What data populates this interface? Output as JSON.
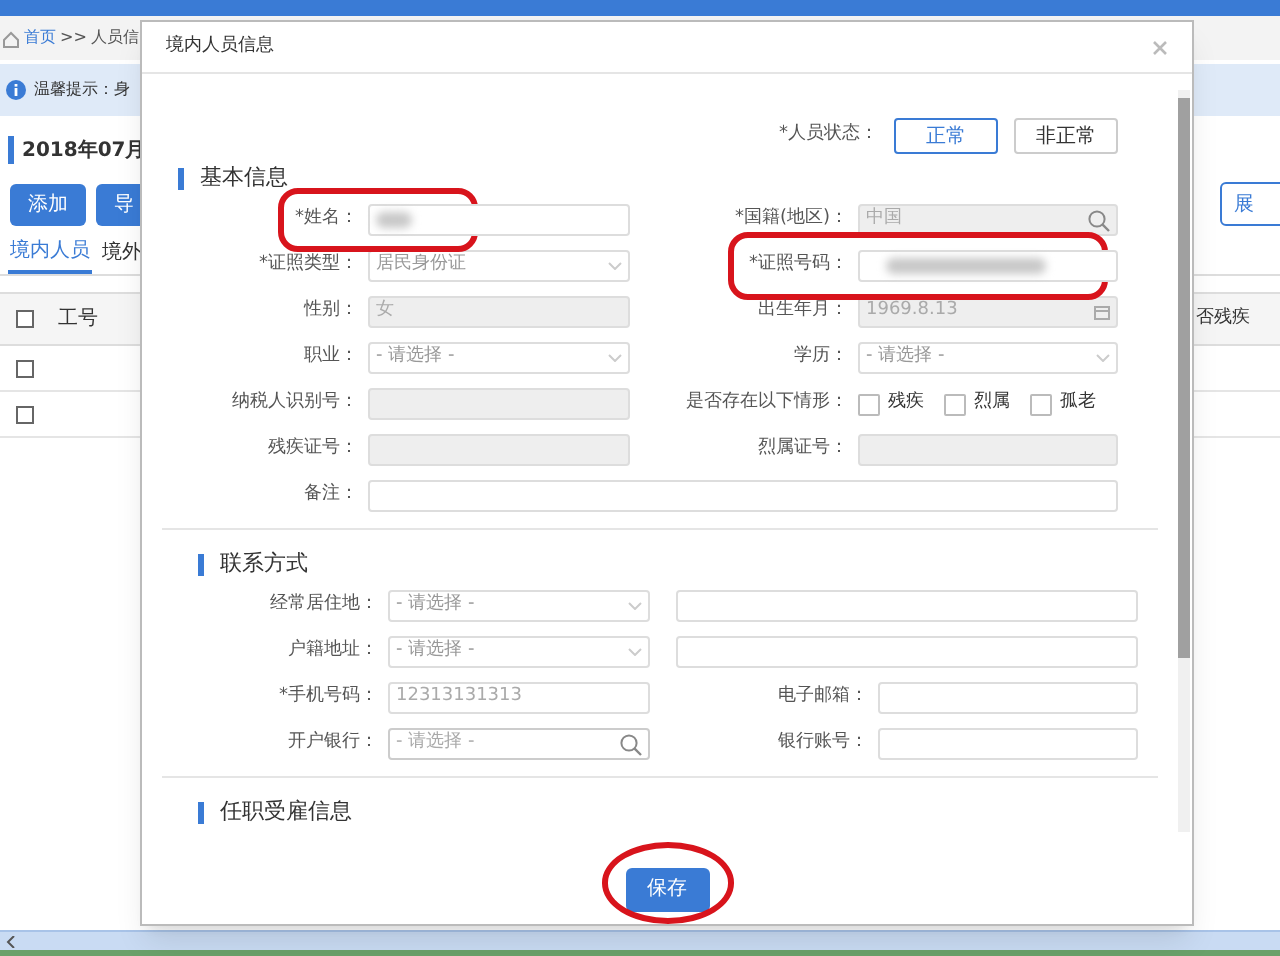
{
  "background": {
    "breadcrumb": [
      "首页",
      ">>",
      "人员信"
    ],
    "tip": "温馨提示：身",
    "heading": "2018年07月",
    "buttons": [
      "添加",
      "导"
    ],
    "right_button": "展",
    "tabs": [
      {
        "label": "境内人员",
        "selected": true
      },
      {
        "label": "境外",
        "selected": false
      }
    ],
    "table": {
      "columns": [
        "工号",
        "否残疾"
      ],
      "header_checked": false,
      "rows": [
        {
          "checked": false
        },
        {
          "checked": false
        }
      ]
    }
  },
  "dialog": {
    "title": "境内人员信息",
    "status": {
      "label": "*人员状态：",
      "options": [
        {
          "label": "正常",
          "selected": true
        },
        {
          "label": "非正常",
          "selected": false
        }
      ]
    },
    "sections": [
      {
        "title": "基本信息",
        "rows": [
          [
            {
              "kind": "blurred",
              "label": "*姓名：",
              "circled": true
            },
            {
              "kind": "search",
              "label": "*国籍(地区)：",
              "value": "中国",
              "circled": false
            }
          ],
          [
            {
              "kind": "select",
              "label": "*证照类型：",
              "value": "居民身份证",
              "circled": false
            },
            {
              "kind": "blurred",
              "label": "*证照号码：",
              "circled": true
            }
          ],
          [
            {
              "kind": "readonly",
              "label": "性别：",
              "value": "女",
              "circled": false
            },
            {
              "kind": "date",
              "label": "出生年月：",
              "value": "1969.8.13",
              "circled": false
            }
          ],
          [
            {
              "kind": "select",
              "label": "职业：",
              "placeholder": "- 请选择 -",
              "circled": false
            },
            {
              "kind": "select",
              "label": "学历：",
              "placeholder": "- 请选择 -",
              "circled": false
            }
          ],
          [
            {
              "kind": "readonly",
              "label": "纳税人识别号：",
              "circled": false
            },
            {
              "kind": "checks",
              "label": "是否存在以下情形：",
              "options": [
                {
                  "label": "残疾",
                  "checked": false
                },
                {
                  "label": "烈属",
                  "checked": false
                },
                {
                  "label": "孤老",
                  "checked": false
                }
              ],
              "circled": false
            }
          ],
          [
            {
              "kind": "readonly",
              "label": "残疾证号：",
              "circled": false
            },
            {
              "kind": "readonly",
              "label": "烈属证号：",
              "circled": false
            }
          ],
          [
            {
              "kind": "wide",
              "label": "备注：",
              "circled": false
            }
          ]
        ]
      },
      {
        "title": "联系方式",
        "rows": [
          [
            {
              "kind": "select",
              "label": "经常居住地：",
              "placeholder": "- 请选择 -",
              "circled": false
            },
            {
              "kind": "extra",
              "circled": false
            }
          ],
          [
            {
              "kind": "select",
              "label": "户籍地址：",
              "placeholder": "- 请选择 -",
              "circled": false
            },
            {
              "kind": "extra",
              "circled": false
            }
          ],
          [
            {
              "kind": "text",
              "label": "*手机号码：",
              "value": "12313131313",
              "circled": false
            },
            {
              "kind": "text",
              "label": "电子邮箱：",
              "circled": false
            }
          ],
          [
            {
              "kind": "search",
              "label": "开户银行：",
              "placeholder": "- 请选择 -",
              "circled": false
            },
            {
              "kind": "text",
              "label": "银行账号：",
              "circled": false
            }
          ]
        ]
      },
      {
        "title": "任职受雇信息"
      }
    ],
    "save": {
      "label": "保存",
      "circled": true
    }
  }
}
